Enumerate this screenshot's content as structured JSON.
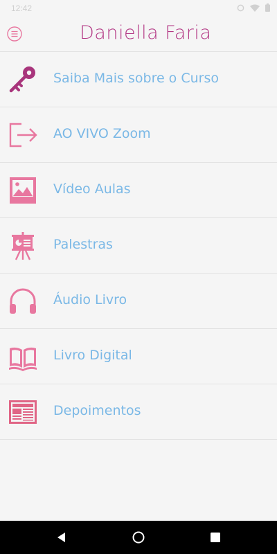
{
  "status_bar": {
    "time": "12:42"
  },
  "app": {
    "title": "Daniella Faria"
  },
  "menu": {
    "items": [
      {
        "label": "Saiba Mais sobre o Curso",
        "icon": "key-icon"
      },
      {
        "label": "AO VIVO Zoom",
        "icon": "sign-out-icon"
      },
      {
        "label": "Vídeo Aulas",
        "icon": "image-icon"
      },
      {
        "label": "Palestras",
        "icon": "presentation-board-icon"
      },
      {
        "label": "Áudio Livro",
        "icon": "headphones-icon"
      },
      {
        "label": "Livro Digital",
        "icon": "open-book-icon"
      },
      {
        "label": "Depoimentos",
        "icon": "newspaper-icon"
      }
    ]
  },
  "colors": {
    "title": "#b43a86",
    "label": "#7ab8e6",
    "icon_pink": "#e8779f",
    "icon_purple": "#b43a86",
    "background": "#f5f5f5",
    "divider": "#e2e2e2"
  }
}
